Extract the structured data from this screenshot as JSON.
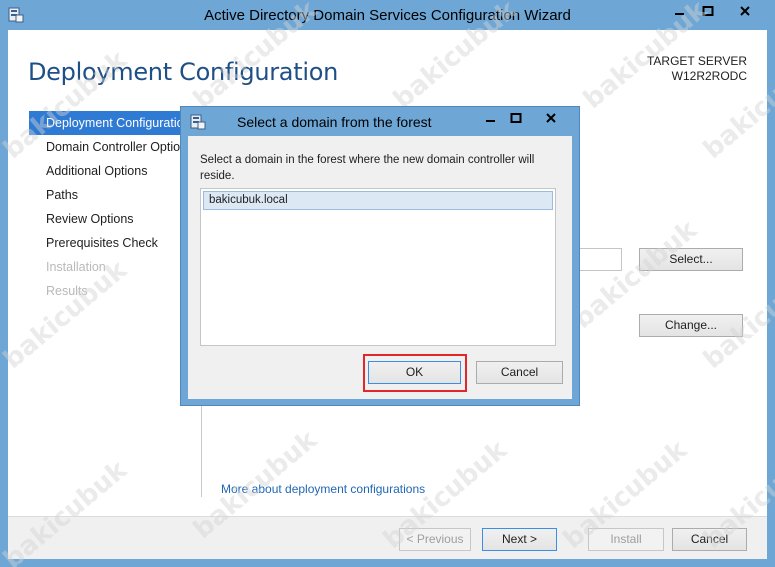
{
  "window": {
    "title": "Active Directory Domain Services Configuration Wizard"
  },
  "header": {
    "title": "Deployment Configuration",
    "target_label": "TARGET SERVER",
    "target_name": "W12R2RODC"
  },
  "nav": {
    "items": [
      {
        "label": "Deployment Configuration",
        "state": "active"
      },
      {
        "label": "Domain Controller Options",
        "state": "normal"
      },
      {
        "label": "Additional Options",
        "state": "normal"
      },
      {
        "label": "Paths",
        "state": "normal"
      },
      {
        "label": "Review Options",
        "state": "normal"
      },
      {
        "label": "Prerequisites Check",
        "state": "normal"
      },
      {
        "label": "Installation",
        "state": "disabled"
      },
      {
        "label": "Results",
        "state": "disabled"
      }
    ]
  },
  "main": {
    "select_button": "Select...",
    "change_button": "Change...",
    "more_link": "More about deployment configurations"
  },
  "footer": {
    "previous": "< Previous",
    "next": "Next >",
    "install": "Install",
    "cancel": "Cancel"
  },
  "dialog": {
    "title": "Select a domain from the forest",
    "message": "Select a domain in the forest where the new domain controller will reside.",
    "domains": [
      "bakicubuk.local"
    ],
    "ok": "OK",
    "cancel": "Cancel"
  },
  "watermark": "bakicubuk",
  "colors": {
    "title_bar": "#6ea7d6",
    "header_title": "#1e4f86",
    "nav_active": "#2f7ad3",
    "link": "#1f67b4",
    "highlight": "#e0282a"
  }
}
